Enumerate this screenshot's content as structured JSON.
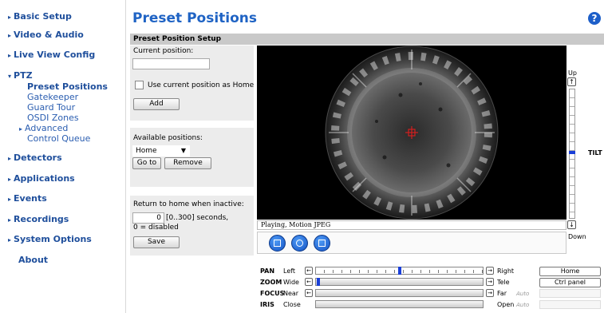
{
  "nav": {
    "basic_setup": "Basic Setup",
    "video_audio": "Video & Audio",
    "live_view_config": "Live View Config",
    "ptz": "PTZ",
    "ptz_items": [
      "Preset Positions",
      "Gatekeeper",
      "Guard Tour",
      "OSDI Zones"
    ],
    "advanced": "Advanced",
    "control_queue": "Control Queue",
    "detectors": "Detectors",
    "applications": "Applications",
    "events": "Events",
    "recordings": "Recordings",
    "system_options": "System Options",
    "about": "About"
  },
  "page": {
    "title": "Preset Positions",
    "help": "?",
    "section_header": "Preset Position Setup"
  },
  "form": {
    "current_position_label": "Current position:",
    "current_position_value": "",
    "use_current_home_label": "Use current position as Home",
    "add_label": "Add",
    "available_positions_label": "Available positions:",
    "available_selected": "Home",
    "goto_label": "Go to",
    "remove_label": "Remove",
    "return_home_label": "Return to home when inactive:",
    "return_home_value": "0",
    "return_home_range": "[0..300] seconds,",
    "return_home_disabled": "0 = disabled",
    "save_label": "Save"
  },
  "video": {
    "status": "Playing, Motion JPEG"
  },
  "tilt": {
    "up": "Up",
    "down": "Down",
    "label": "TILT",
    "level": 0.5
  },
  "ptz": {
    "pan": {
      "name": "PAN",
      "lo": "Left",
      "hi": "Right",
      "level": 0.5
    },
    "zoom": {
      "name": "ZOOM",
      "lo": "Wide",
      "hi": "Tele",
      "level": 0.0
    },
    "focus": {
      "name": "FOCUS",
      "lo": "Near",
      "hi": "Far",
      "auto": "Auto"
    },
    "iris": {
      "name": "IRIS",
      "lo": "Close",
      "hi": "Open",
      "auto": "Auto"
    },
    "home_button": "Home",
    "ctrl_panel_button": "Ctrl panel"
  },
  "colors": {
    "accent": "#1f63c4",
    "slider_thumb": "#1a3fd8"
  }
}
